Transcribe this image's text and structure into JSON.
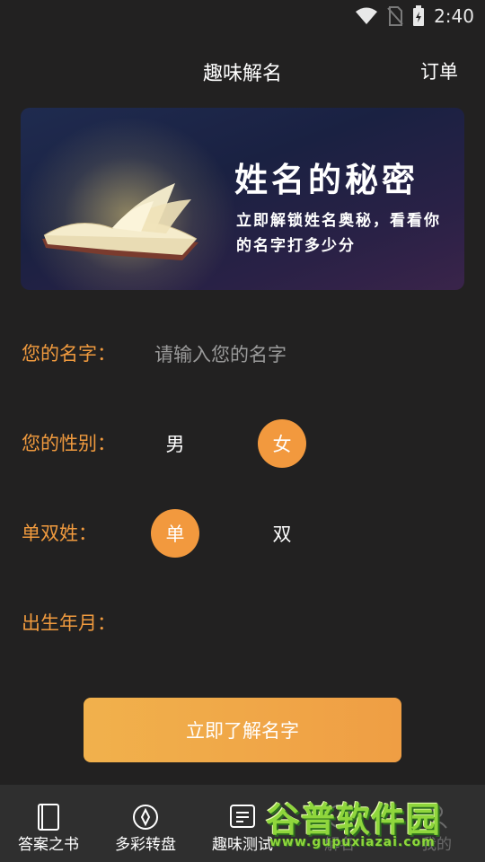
{
  "status_bar": {
    "time": "2:40"
  },
  "header": {
    "title": "趣味解名",
    "orders_label": "订单"
  },
  "banner": {
    "title": "姓名的秘密",
    "subtitle": "立即解锁姓名奥秘，看看你的名字打多少分"
  },
  "form": {
    "name_label": "您的名字：",
    "name_placeholder": "请输入您的名字",
    "name_value": "",
    "gender_label": "您的性别：",
    "gender_options": [
      "男",
      "女"
    ],
    "gender_selected": "女",
    "surname_label": "单双姓：",
    "surname_options": [
      "单",
      "双"
    ],
    "surname_selected": "单",
    "birth_label": "出生年月：",
    "birth_value": ""
  },
  "submit_label": "立即了解名字",
  "tabbar": {
    "items": [
      {
        "label": "答案之书",
        "icon": "book-icon"
      },
      {
        "label": "多彩转盘",
        "icon": "compass-icon"
      },
      {
        "label": "趣味测试",
        "icon": "list-icon"
      },
      {
        "label": "解名",
        "icon": "name-icon"
      },
      {
        "label": "我的",
        "icon": "profile-icon"
      }
    ]
  },
  "watermark": {
    "text": "谷普软件园",
    "url": "www.gupuxiazai.com"
  },
  "colors": {
    "accent": "#f2993e",
    "background": "#222121",
    "tabbar": "#2f2f2f"
  }
}
